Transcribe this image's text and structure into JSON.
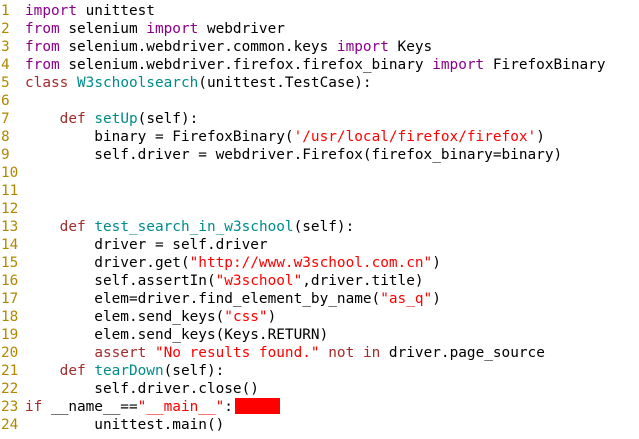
{
  "editor": {
    "lines": [
      {
        "n": "1",
        "parts": [
          {
            "t": "import",
            "c": "kw"
          },
          {
            "t": " unittest",
            "c": ""
          }
        ]
      },
      {
        "n": "2",
        "parts": [
          {
            "t": "from",
            "c": "kw"
          },
          {
            "t": " selenium ",
            "c": ""
          },
          {
            "t": "import",
            "c": "kw"
          },
          {
            "t": " webdriver",
            "c": ""
          }
        ]
      },
      {
        "n": "3",
        "parts": [
          {
            "t": "from",
            "c": "kw"
          },
          {
            "t": " selenium.webdriver.common.keys ",
            "c": ""
          },
          {
            "t": "import",
            "c": "kw"
          },
          {
            "t": " Keys",
            "c": ""
          }
        ]
      },
      {
        "n": "4",
        "parts": [
          {
            "t": "from",
            "c": "kw"
          },
          {
            "t": " selenium.webdriver.firefox.firefox_binary ",
            "c": ""
          },
          {
            "t": "import",
            "c": "kw"
          },
          {
            "t": " FirefoxBinary",
            "c": ""
          }
        ]
      },
      {
        "n": "5",
        "parts": [
          {
            "t": "class",
            "c": "kw2"
          },
          {
            "t": " ",
            "c": ""
          },
          {
            "t": "W3schoolsearch",
            "c": "cls"
          },
          {
            "t": "(unittest.TestCase):",
            "c": ""
          }
        ]
      },
      {
        "n": "6",
        "parts": []
      },
      {
        "n": "7",
        "parts": [
          {
            "t": "    ",
            "c": ""
          },
          {
            "t": "def",
            "c": "kw2"
          },
          {
            "t": " ",
            "c": ""
          },
          {
            "t": "setUp",
            "c": "fn"
          },
          {
            "t": "(self):",
            "c": ""
          }
        ]
      },
      {
        "n": "8",
        "parts": [
          {
            "t": "        binary = FirefoxBinary(",
            "c": ""
          },
          {
            "t": "'/usr/local/firefox/firefox'",
            "c": "str"
          },
          {
            "t": ")",
            "c": ""
          }
        ]
      },
      {
        "n": "9",
        "parts": [
          {
            "t": "        self.driver = webdriver.Firefox(firefox_binary=binary)",
            "c": ""
          }
        ]
      },
      {
        "n": "10",
        "parts": []
      },
      {
        "n": "11",
        "parts": []
      },
      {
        "n": "12",
        "parts": []
      },
      {
        "n": "13",
        "parts": [
          {
            "t": "    ",
            "c": ""
          },
          {
            "t": "def",
            "c": "kw2"
          },
          {
            "t": " ",
            "c": ""
          },
          {
            "t": "test_search_in_w3school",
            "c": "fn"
          },
          {
            "t": "(self):",
            "c": ""
          }
        ]
      },
      {
        "n": "14",
        "parts": [
          {
            "t": "        driver = self.driver",
            "c": ""
          }
        ]
      },
      {
        "n": "15",
        "parts": [
          {
            "t": "        driver.get(",
            "c": ""
          },
          {
            "t": "\"http://www.w3school.com.cn\"",
            "c": "str"
          },
          {
            "t": ")",
            "c": ""
          }
        ]
      },
      {
        "n": "16",
        "parts": [
          {
            "t": "        self.assertIn(",
            "c": ""
          },
          {
            "t": "\"w3school\"",
            "c": "str"
          },
          {
            "t": ",driver.title)",
            "c": ""
          }
        ]
      },
      {
        "n": "17",
        "parts": [
          {
            "t": "        elem=driver.find_element_by_name(",
            "c": ""
          },
          {
            "t": "\"as_q\"",
            "c": "str"
          },
          {
            "t": ")",
            "c": ""
          }
        ]
      },
      {
        "n": "18",
        "parts": [
          {
            "t": "        elem.send_keys(",
            "c": ""
          },
          {
            "t": "\"css\"",
            "c": "str"
          },
          {
            "t": ")",
            "c": ""
          }
        ]
      },
      {
        "n": "19",
        "parts": [
          {
            "t": "        elem.send_keys(Keys.RETURN)",
            "c": ""
          }
        ]
      },
      {
        "n": "20",
        "parts": [
          {
            "t": "        ",
            "c": ""
          },
          {
            "t": "assert",
            "c": "kw2"
          },
          {
            "t": " ",
            "c": ""
          },
          {
            "t": "\"No results found.\"",
            "c": "str"
          },
          {
            "t": " ",
            "c": ""
          },
          {
            "t": "not",
            "c": "kw2"
          },
          {
            "t": " ",
            "c": ""
          },
          {
            "t": "in",
            "c": "kw2"
          },
          {
            "t": " driver.page_source",
            "c": ""
          }
        ]
      },
      {
        "n": "21",
        "parts": [
          {
            "t": "    ",
            "c": ""
          },
          {
            "t": "def",
            "c": "kw2"
          },
          {
            "t": " ",
            "c": ""
          },
          {
            "t": "tearDown",
            "c": "fn"
          },
          {
            "t": "(self):",
            "c": ""
          }
        ]
      },
      {
        "n": "22",
        "parts": [
          {
            "t": "        self.driver.close()",
            "c": ""
          }
        ]
      },
      {
        "n": "23",
        "parts": [
          {
            "t": "if",
            "c": "kw2"
          },
          {
            "t": " __name__==",
            "c": ""
          },
          {
            "t": "\"__main__\"",
            "c": "str"
          },
          {
            "t": ":",
            "c": ""
          }
        ],
        "redacted": true
      },
      {
        "n": "24",
        "parts": [
          {
            "t": "        unittest.main()",
            "c": ""
          }
        ]
      }
    ]
  }
}
